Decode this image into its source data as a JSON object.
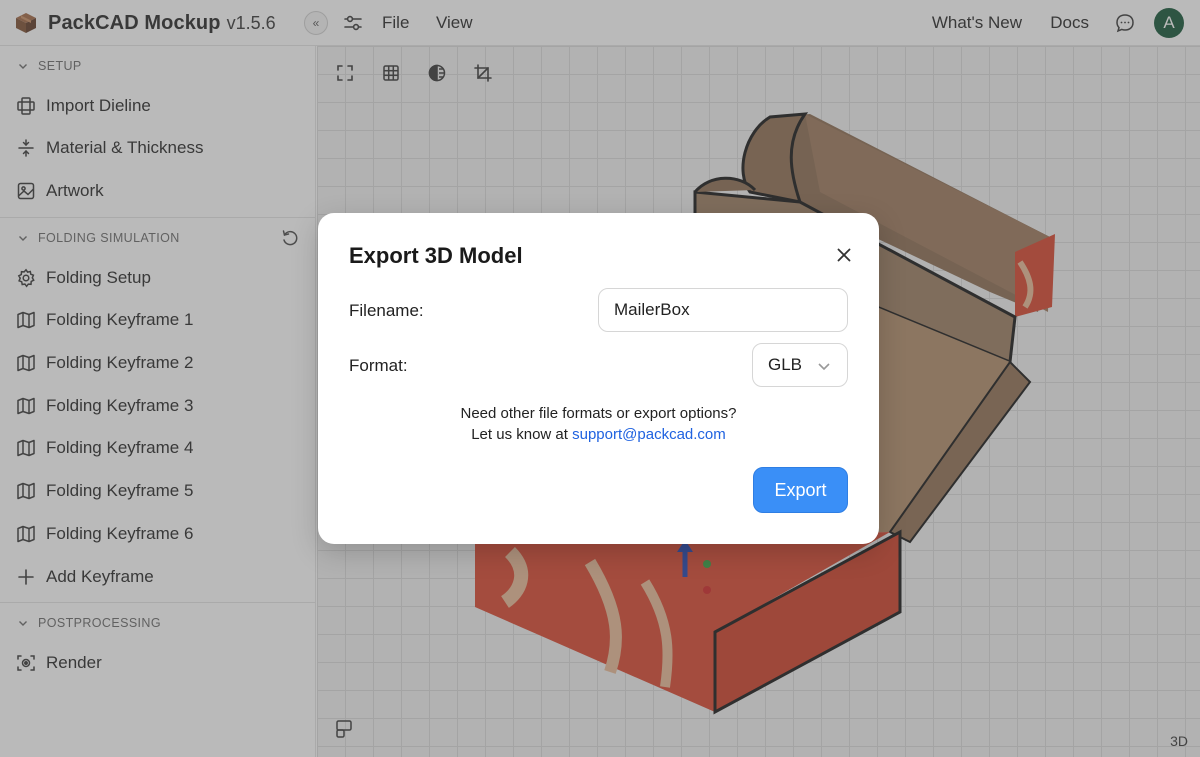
{
  "app": {
    "name": "PackCAD Mockup",
    "version": "v1.5.6",
    "brand_color": "#6b3f2a"
  },
  "menu": {
    "file": "File",
    "view": "View"
  },
  "header_right": {
    "whats_new": "What's New",
    "docs": "Docs",
    "avatar_initial": "A",
    "avatar_color": "#0f5132"
  },
  "sidebar": {
    "sections": [
      {
        "title": "SETUP",
        "items": [
          {
            "label": "Import Dieline",
            "icon": "dieline-icon"
          },
          {
            "label": "Material & Thickness",
            "icon": "thickness-icon"
          },
          {
            "label": "Artwork",
            "icon": "image-icon"
          }
        ]
      },
      {
        "title": "FOLDING SIMULATION",
        "items": [
          {
            "label": "Folding Setup",
            "icon": "gear-icon"
          },
          {
            "label": "Folding Keyframe 1",
            "icon": "map-icon"
          },
          {
            "label": "Folding Keyframe 2",
            "icon": "map-icon"
          },
          {
            "label": "Folding Keyframe 3",
            "icon": "map-icon"
          },
          {
            "label": "Folding Keyframe 4",
            "icon": "map-icon"
          },
          {
            "label": "Folding Keyframe 5",
            "icon": "map-icon"
          },
          {
            "label": "Folding Keyframe 6",
            "icon": "map-icon"
          },
          {
            "label": "Add Keyframe",
            "icon": "plus-icon"
          }
        ]
      },
      {
        "title": "POSTPROCESSING",
        "items": [
          {
            "label": "Render",
            "icon": "render-icon"
          }
        ]
      }
    ]
  },
  "canvas": {
    "mode_label": "3D",
    "tools": [
      "fullscreen-icon",
      "grid-icon",
      "lighting-icon",
      "crop-icon"
    ]
  },
  "modal": {
    "title": "Export 3D Model",
    "filename_label": "Filename:",
    "filename_value": "MailerBox",
    "format_label": "Format:",
    "format_value": "GLB",
    "help_line1": "Need other file formats or export options?",
    "help_line2_prefix": "Let us know at",
    "help_email": "support@packcad.com",
    "export_label": "Export",
    "accent_color": "#3a8ff7"
  }
}
